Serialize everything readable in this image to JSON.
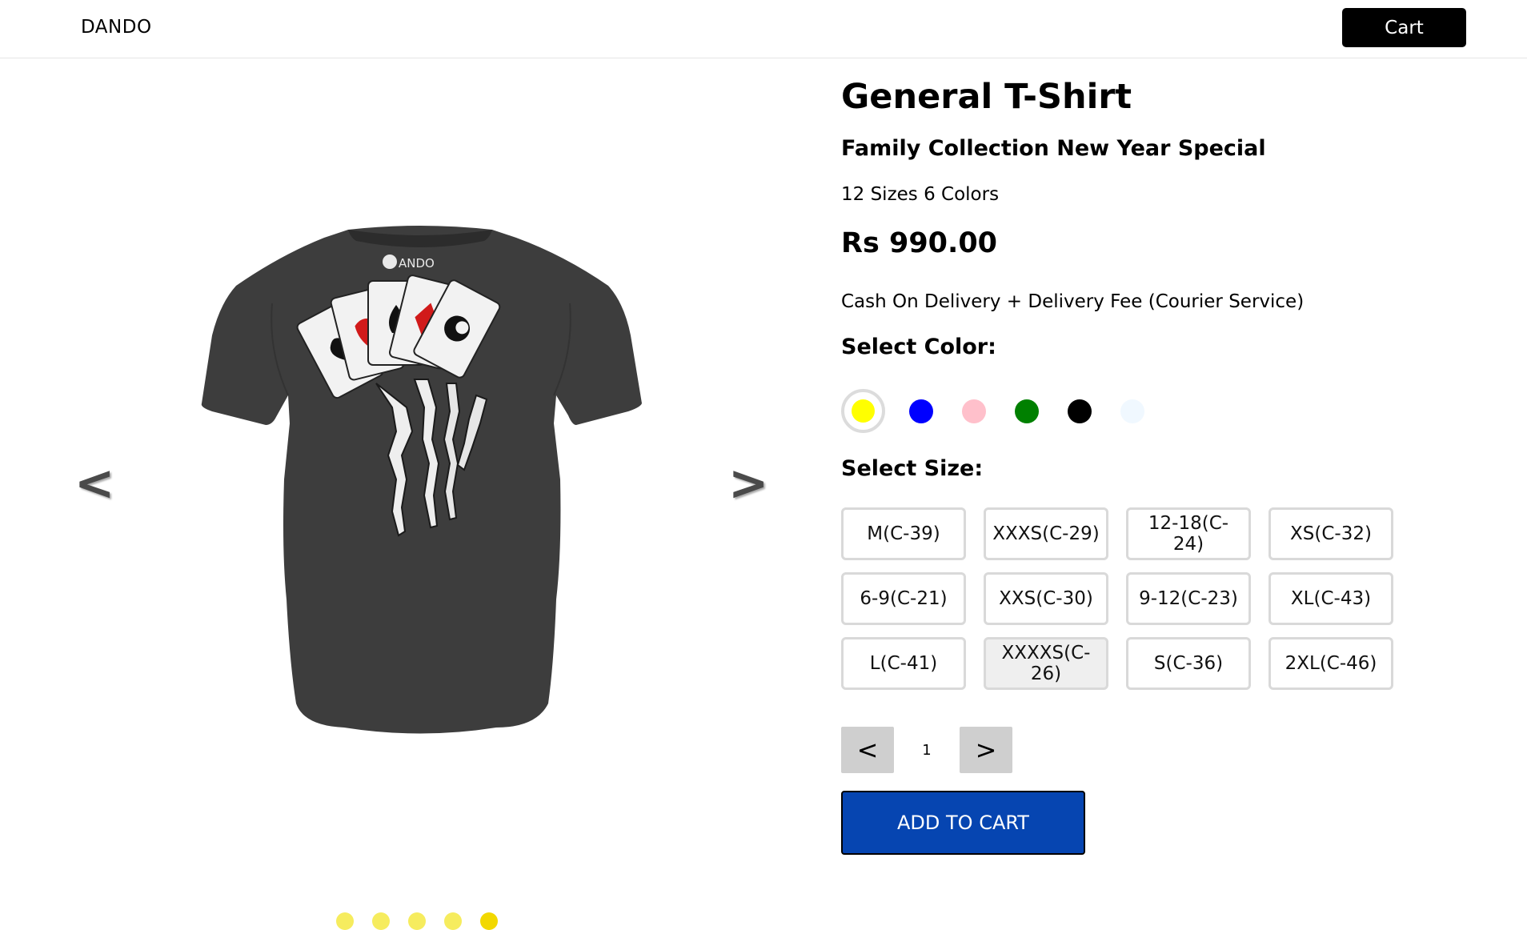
{
  "header": {
    "brand": "DANDO",
    "cart_label": "Cart"
  },
  "gallery": {
    "prev_label": "<",
    "next_label": ">",
    "image_alt": "Black t-shirt back with skeleton hand holding cards",
    "logo_text": "ANDO",
    "dot_count": 5,
    "active_dot": 4
  },
  "product": {
    "title": "General T-Shirt",
    "subtitle": "Family Collection New Year Special",
    "variants": "12 Sizes 6 Colors",
    "price": "Rs 990.00",
    "delivery": "Cash On Delivery + Delivery Fee (Courier Service)",
    "color_label": "Select Color:",
    "size_label": "Select Size:",
    "colors": [
      {
        "name": "yellow",
        "hex": "#ffff00",
        "selected": true
      },
      {
        "name": "blue",
        "hex": "#0000ff",
        "selected": false
      },
      {
        "name": "pink",
        "hex": "#ffc0cb",
        "selected": false
      },
      {
        "name": "green",
        "hex": "#008000",
        "selected": false
      },
      {
        "name": "black",
        "hex": "#000000",
        "selected": false
      },
      {
        "name": "aliceblue",
        "hex": "#f0f8ff",
        "selected": false
      }
    ],
    "sizes": [
      "M(C-39)",
      "XXXS(C-29)",
      "12-18(C-24)",
      "XS(C-32)",
      "6-9(C-21)",
      "XXS(C-30)",
      "9-12(C-23)",
      "XL(C-43)",
      "L(C-41)",
      "XXXXS(C-26)",
      "S(C-36)",
      "2XL(C-46)"
    ],
    "quantity": {
      "decrement_label": "<",
      "value": "1",
      "increment_label": ">"
    },
    "add_to_cart_label": "ADD TO CART"
  }
}
